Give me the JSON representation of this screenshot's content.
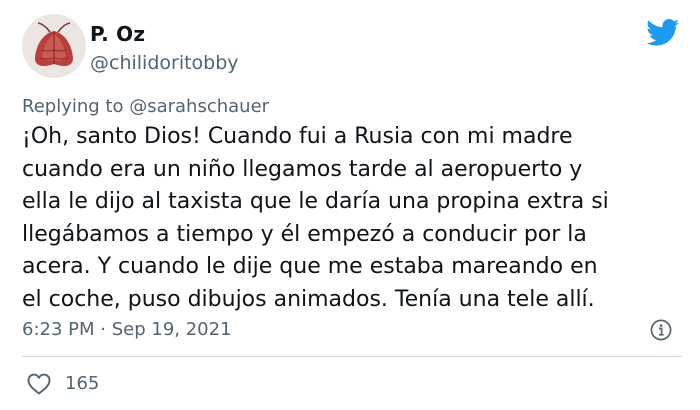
{
  "author": {
    "display_name": "P. Oz",
    "handle": "@chilidoritobby"
  },
  "reply": {
    "prefix": "Replying to",
    "mention": "@sarahschauer"
  },
  "body": {
    "lines": [
      "¡Oh, santo Dios! Cuando fui a Rusia con mi madre",
      "cuando era un niño llegamos tarde al aeropuerto y",
      "ella le dijo al taxista que le daría una propina extra si",
      "llegábamos a tiempo y él empezó a conducir por la",
      "acera. Y cuando le dije que me estaba mareando en",
      "el coche, puso dibujos animados. Tenía una tele allí."
    ]
  },
  "meta": {
    "time": "6:23 PM",
    "separator": "·",
    "date": "Sep 19, 2021"
  },
  "actions": {
    "like_count": "165"
  },
  "icons": {
    "logo": "twitter-bird-icon",
    "info": "info-icon",
    "like": "heart-icon"
  },
  "colors": {
    "brand": "#1d9bf0",
    "text": "#0f1419",
    "secondary": "#536471",
    "divider": "#cfd9de"
  }
}
